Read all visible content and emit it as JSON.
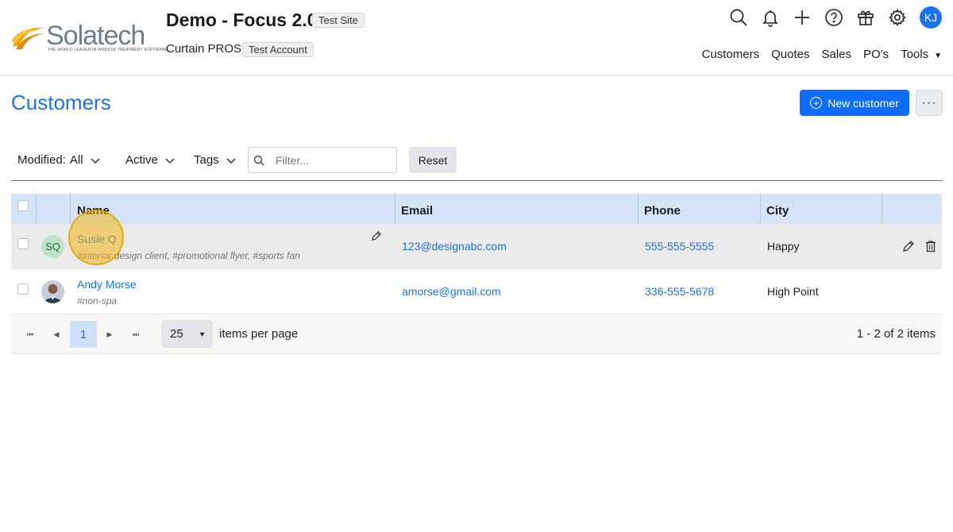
{
  "header": {
    "logo_text": "Solatech",
    "logo_tagline": "THE WORLD LEADER IN WINDOW TREATMENT SOFTWARE",
    "app_title": "Demo - Focus 2.0",
    "site_badge": "Test Site",
    "account_name": "Curtain PROS",
    "account_badge": "Test Account",
    "user_initials": "KJ",
    "icons": [
      "search-icon",
      "bell-icon",
      "plus-icon",
      "help-icon",
      "gift-icon",
      "gear-icon"
    ],
    "nav": [
      "Customers",
      "Quotes",
      "Sales",
      "PO's",
      "Tools"
    ]
  },
  "page": {
    "title": "Customers",
    "new_button": "New customer",
    "more_button": "···"
  },
  "filters": {
    "modified_label": "Modified:",
    "modified_value": "All",
    "active_label": "Active",
    "tags_label": "Tags",
    "filter_placeholder": "Filter...",
    "reset_label": "Reset"
  },
  "table": {
    "columns": [
      "Name",
      "Email",
      "Phone",
      "City"
    ],
    "rows": [
      {
        "initials": "SQ",
        "name": "Susie Q",
        "tags": "#interior design client, #promotional flyer, #sports fan",
        "email": "123@designabc.com",
        "phone": "555-555-5555",
        "city": "Happy"
      },
      {
        "initials": "",
        "name": "Andy Morse",
        "tags": "#non-spa",
        "email": "amorse@gmail.com",
        "phone": "336-555-5678",
        "city": "High Point"
      }
    ]
  },
  "pager": {
    "current_page": "1",
    "page_size": "25",
    "items_label": "items per page",
    "summary": "1 - 2 of 2 items"
  },
  "colors": {
    "accent": "#1a73e8",
    "button_primary": "#0d6efd",
    "header_row": "#d6e4f7",
    "highlight": "#f0b414"
  }
}
